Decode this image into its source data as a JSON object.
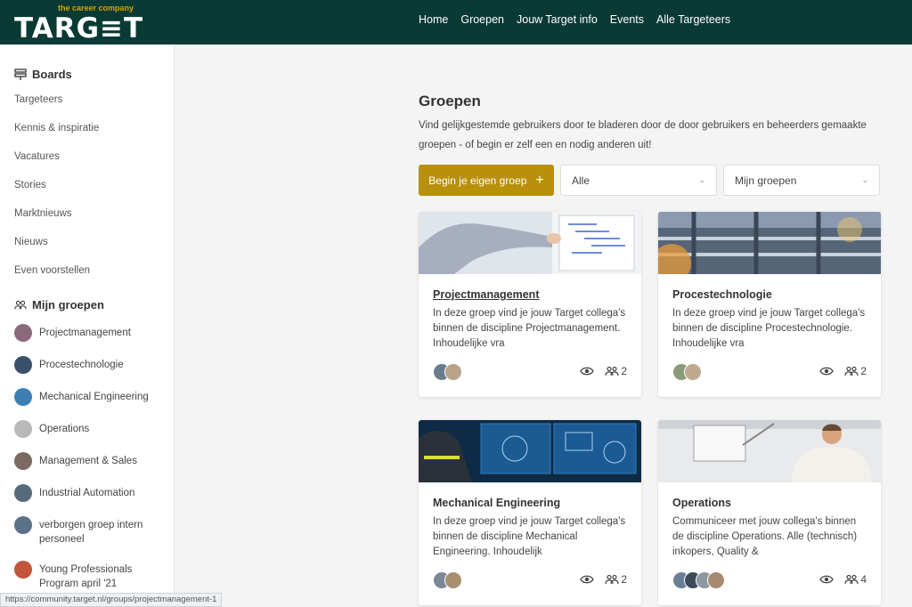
{
  "brand": {
    "tagline": "the career company",
    "wordmark": "TARG≡T"
  },
  "nav": [
    "Home",
    "Groepen",
    "Jouw Target info",
    "Events",
    "Alle Targeteers"
  ],
  "sidebar": {
    "boards_title": "Boards",
    "boards": [
      "Targeteers",
      "Kennis & inspiratie",
      "Vacatures",
      "Stories",
      "Marktnieuws",
      "Nieuws",
      "Even voorstellen"
    ],
    "groups_title": "Mijn groepen",
    "groups": [
      {
        "label": "Projectmanagement",
        "color": "#8a6a7a"
      },
      {
        "label": "Procestechnologie",
        "color": "#3a4f6a"
      },
      {
        "label": "Mechanical Engineering",
        "color": "#3b7fb5"
      },
      {
        "label": "Operations",
        "color": "#b9b9b9"
      },
      {
        "label": "Management & Sales",
        "color": "#7a6a62"
      },
      {
        "label": "Industrial Automation",
        "color": "#566b7a"
      },
      {
        "label": "verborgen groep intern personeel",
        "color": "#5a7188"
      },
      {
        "label": "Young Professionals Program april '21",
        "color": "#c2553a"
      }
    ]
  },
  "main": {
    "title": "Groepen",
    "description": "Vind gelijkgestemde gebruikers door te bladeren door de door gebruikers en beheerders gemaakte groepen - of begin er zelf een en nodig anderen uit!",
    "new_group_button": "Begin je eigen groep",
    "filter_all": "Alle",
    "filter_mine": "Mijn groepen",
    "cards": [
      {
        "title": "Projectmanagement",
        "description": "In deze groep vind je jouw Target collega's binnen de discipline Projectmanagement. Inhoudelijke vra",
        "members": "2"
      },
      {
        "title": "Procestechnologie",
        "description": "In deze groep vind je jouw Target collega's binnen de discipline Procestechnologie. Inhoudelijke vra",
        "members": "2"
      },
      {
        "title": "Mechanical Engineering",
        "description": "In deze groep vind je jouw Target collega's binnen de discipline Mechanical Engineering. Inhoudelijk",
        "members": "2"
      },
      {
        "title": "Operations",
        "description": "Communiceer met jouw collega's binnen de discipline Operations. Alle (technisch) inkopers, Quality &",
        "members": "4"
      }
    ]
  },
  "status_url": "https://community.target.nl/groups/projectmanagement-1",
  "colors": {
    "header": "#0a3a34",
    "accent": "#b8900a"
  }
}
